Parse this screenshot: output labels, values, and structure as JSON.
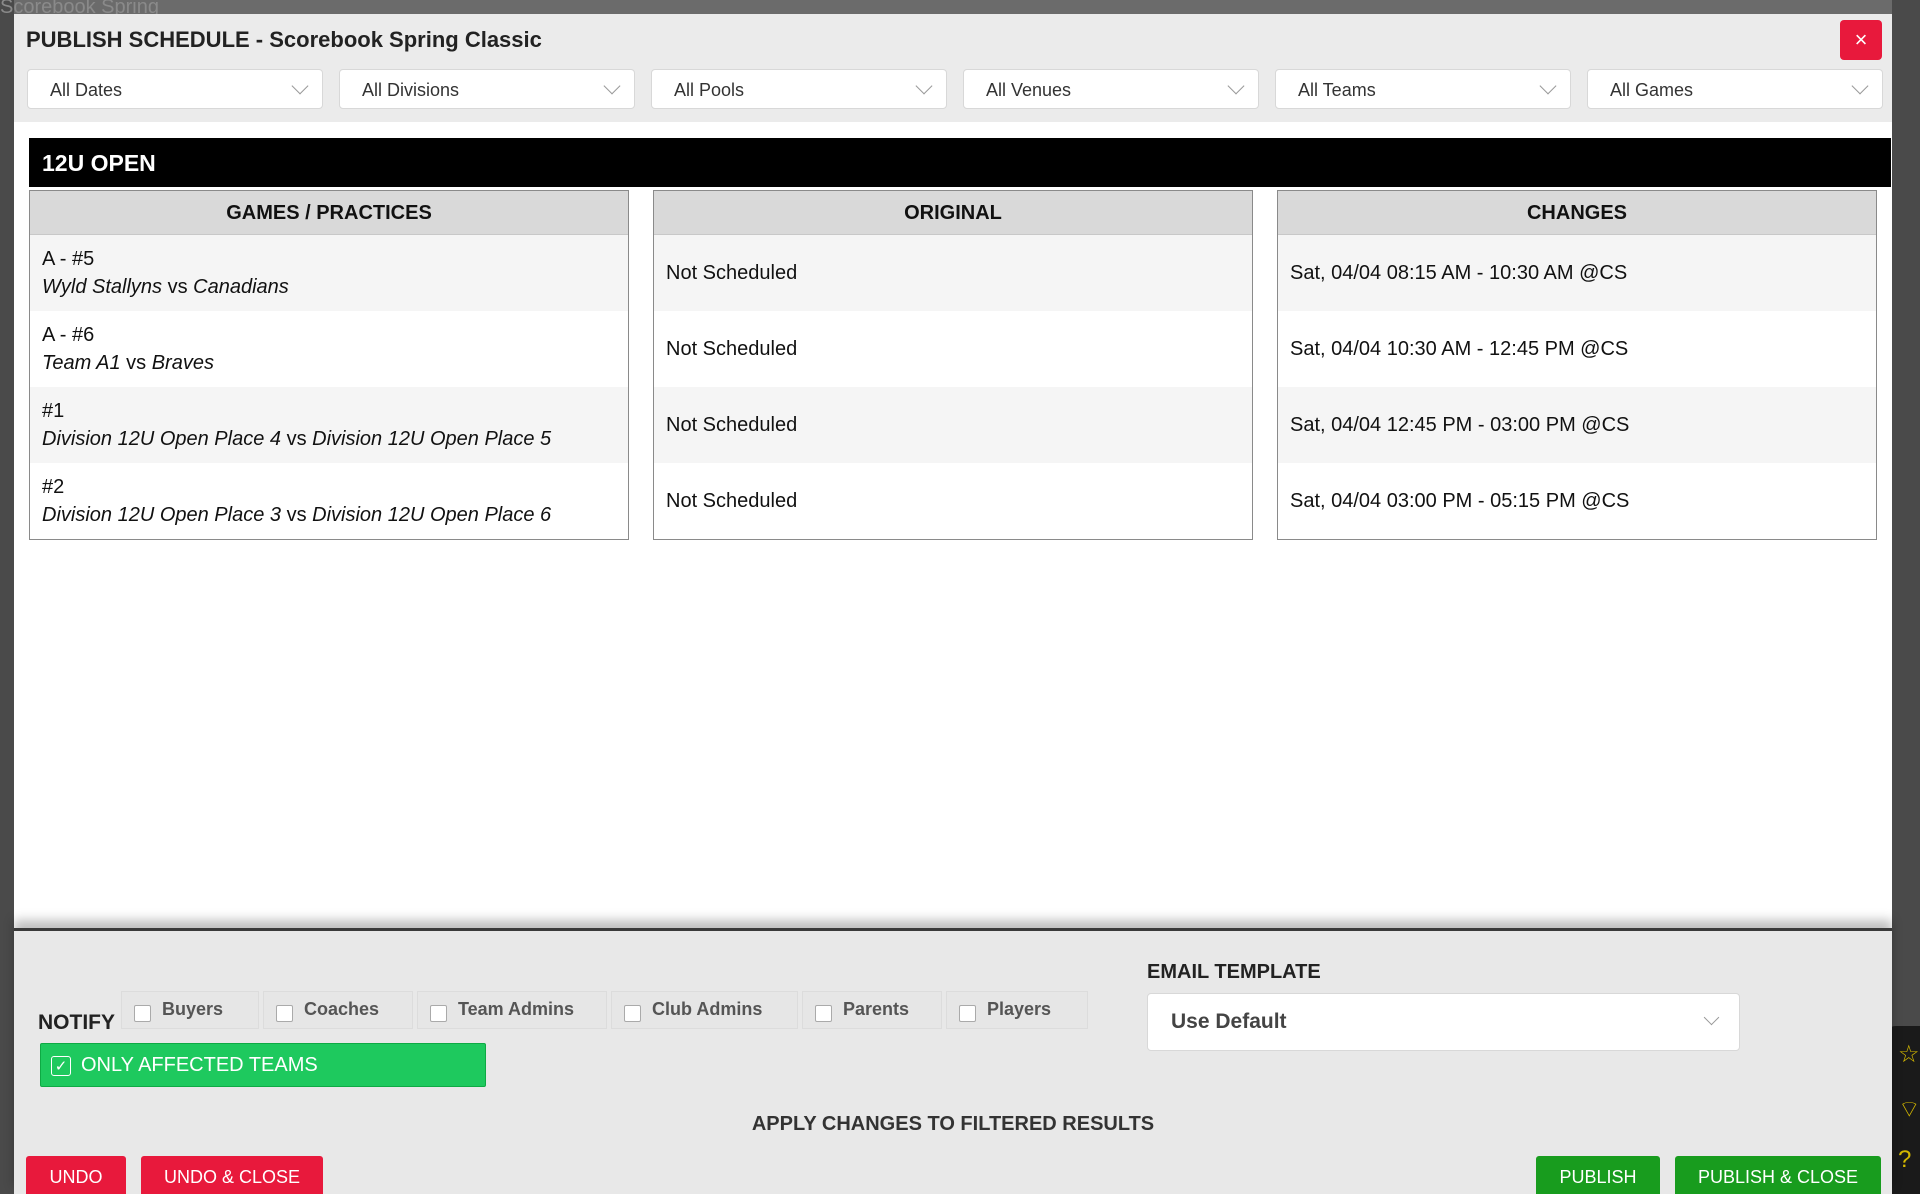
{
  "background": {
    "title_fragment": "Scorebook Spring"
  },
  "modal": {
    "title": "PUBLISH SCHEDULE - Scorebook Spring Classic",
    "close_icon": "×"
  },
  "filters": [
    {
      "label": "All Dates"
    },
    {
      "label": "All Divisions"
    },
    {
      "label": "All Pools"
    },
    {
      "label": "All Venues"
    },
    {
      "label": "All Teams"
    },
    {
      "label": "All Games"
    }
  ],
  "division": {
    "name": "12U OPEN"
  },
  "tables": {
    "games_header": "GAMES / PRACTICES",
    "original_header": "ORIGINAL",
    "changes_header": "CHANGES",
    "vs": "vs",
    "rows": [
      {
        "game": "A - #5",
        "team1": "Wyld Stallyns",
        "team2": "Canadians",
        "original": "Not Scheduled",
        "change": "Sat, 04/04 08:15 AM - 10:30 AM @CS"
      },
      {
        "game": "A - #6",
        "team1": "Team A1",
        "team2": "Braves",
        "original": "Not Scheduled",
        "change": "Sat, 04/04 10:30 AM - 12:45 PM @CS"
      },
      {
        "game": "#1",
        "team1": "Division 12U Open Place 4",
        "team2": "Division 12U Open Place 5",
        "original": "Not Scheduled",
        "change": "Sat, 04/04 12:45 PM - 03:00 PM @CS"
      },
      {
        "game": "#2",
        "team1": "Division 12U Open Place 3",
        "team2": "Division 12U Open Place 6",
        "original": "Not Scheduled",
        "change": "Sat, 04/04 03:00 PM - 05:15 PM @CS"
      }
    ]
  },
  "footer": {
    "notify_label": "NOTIFY",
    "notify_options": [
      {
        "label": "Buyers",
        "checked": false
      },
      {
        "label": "Coaches",
        "checked": false
      },
      {
        "label": "Team Admins",
        "checked": false
      },
      {
        "label": "Club Admins",
        "checked": false
      },
      {
        "label": "Parents",
        "checked": false
      },
      {
        "label": "Players",
        "checked": false
      }
    ],
    "only_affected": {
      "label": "ONLY AFFECTED TEAMS",
      "checked": true
    },
    "email_template_label": "EMAIL TEMPLATE",
    "email_template_value": "Use Default",
    "apply_label": "APPLY CHANGES TO FILTERED RESULTS",
    "undo_label": "UNDO",
    "undo_close_label": "UNDO & CLOSE",
    "publish_label": "PUBLISH",
    "publish_close_label": "PUBLISH & CLOSE"
  },
  "colors": {
    "accent_red": "#e8193c",
    "accent_green": "#189c1e",
    "toggle_green": "#1ec95e",
    "not_scheduled": "#e00000"
  },
  "icons": {
    "side_star": "star-icon",
    "side_broadcast": "broadcast-icon",
    "side_help": "help-icon"
  }
}
